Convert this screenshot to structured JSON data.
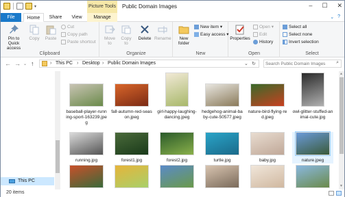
{
  "window": {
    "title": "Public Domain Images",
    "contextual_tab_header": "Picture Tools",
    "controls": [
      "–",
      "☐",
      "✕"
    ]
  },
  "tabs": [
    {
      "label": "File"
    },
    {
      "label": "Home"
    },
    {
      "label": "Share"
    },
    {
      "label": "View"
    },
    {
      "label": "Manage"
    }
  ],
  "ribbon": {
    "clipboard": {
      "label": "Clipboard",
      "pin": "Pin to Quick access",
      "copy": "Copy",
      "paste": "Paste",
      "cut": "Cut",
      "copy_path": "Copy path",
      "paste_shortcut": "Paste shortcut"
    },
    "organize": {
      "label": "Organize",
      "move_to": "Move to",
      "copy_to": "Copy to",
      "delete": "Delete",
      "rename": "Rename"
    },
    "new": {
      "label": "New",
      "new_folder": "New folder",
      "new_item": "New item ▾",
      "easy_access": "Easy access ▾"
    },
    "open": {
      "label": "Open",
      "properties": "Properties",
      "open": "Open ▾",
      "edit": "Edit",
      "history": "History"
    },
    "select": {
      "label": "Select",
      "select_all": "Select all",
      "select_none": "Select none",
      "invert": "Invert selection"
    }
  },
  "address": {
    "path": [
      "This PC",
      "Desktop",
      "Public Domain Images"
    ],
    "search_placeholder": "Search Public Domain Images"
  },
  "navpane": {
    "this_pc": "This PC"
  },
  "files": [
    {
      "name": "baseball-player-running-sport-163239.jpeg",
      "c1": "#c9c4b4",
      "c2": "#6a8a4a"
    },
    {
      "name": "fall-autumn-red-season.jpeg",
      "c1": "#d9662a",
      "c2": "#7a2a14"
    },
    {
      "name": "girl-happy-laughing-dancing.jpeg",
      "c1": "#f1e9d6",
      "c2": "#a8b86a"
    },
    {
      "name": "hedgehog-animal-baby-cute-50577.jpeg",
      "c1": "#e8e6e0",
      "c2": "#8a7a5a"
    },
    {
      "name": "nature-bird-flying-red.jpeg",
      "c1": "#3a6a2a",
      "c2": "#c84020"
    },
    {
      "name": "owl-glitter-stuffed-animal-cute.jpg",
      "c1": "#2a2a2a",
      "c2": "#b0b0b0"
    },
    {
      "name": "running.jpg",
      "c1": "#dadada",
      "c2": "#555555"
    },
    {
      "name": "forest1.jpg",
      "c1": "#4a6a3a",
      "c2": "#1a3a1a"
    },
    {
      "name": "forest2.jpg",
      "c1": "#2a5a2a",
      "c2": "#8ab04a"
    },
    {
      "name": "turtle.jpg",
      "c1": "#2aa4c8",
      "c2": "#1a6a8a"
    },
    {
      "name": "baby.jpg",
      "c1": "#e8dcd0",
      "c2": "#c0a898"
    },
    {
      "name": "nature.jpeg",
      "c1": "#6a9ad8",
      "c2": "#3a5a3a"
    },
    {
      "name": "",
      "c1": "#c8502a",
      "c2": "#3a6a3a"
    },
    {
      "name": "",
      "c1": "#e6b43a",
      "c2": "#a8d06a"
    },
    {
      "name": "",
      "c1": "#5a8ac8",
      "c2": "#6a9a4a"
    },
    {
      "name": "",
      "c1": "#d8c4b0",
      "c2": "#7a6a5a"
    },
    {
      "name": "",
      "c1": "#f0e6da",
      "c2": "#d0b8a0"
    },
    {
      "name": "",
      "c1": "#8ab8e0",
      "c2": "#6a8a4a"
    }
  ],
  "status": {
    "item_count": "20 items"
  },
  "colors": {
    "accent": "#1979ca",
    "picture_tools": "#f6e8a8",
    "selection": "#cce8ff"
  }
}
